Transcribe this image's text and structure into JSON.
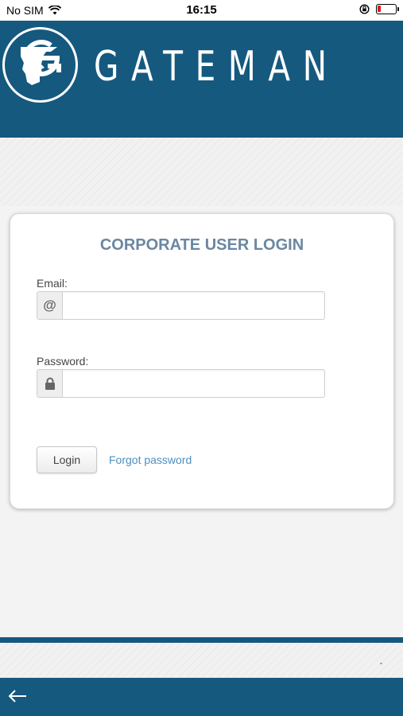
{
  "status_bar": {
    "carrier": "No SIM",
    "time": "16:15",
    "battery_color": "#e0161b"
  },
  "header": {
    "brand": "GATEMAN",
    "logo_letter": "G",
    "background_color": "#15597f"
  },
  "login_card": {
    "title": "CORPORATE USER LOGIN",
    "email_label": "Email:",
    "email_addon": "@",
    "email_value": "",
    "password_label": "Password:",
    "password_value": "",
    "login_button": "Login",
    "forgot_link": "Forgot password"
  },
  "footer": {
    "back_icon": "arrow-left-icon"
  }
}
